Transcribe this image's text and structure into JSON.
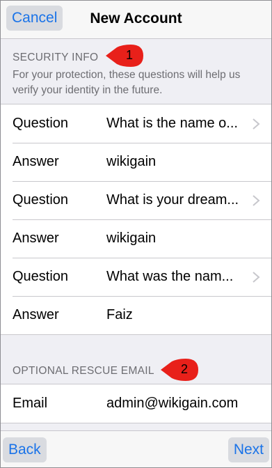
{
  "navbar": {
    "cancel_label": "Cancel",
    "title": "New Account"
  },
  "security": {
    "header": "SECURITY INFO",
    "description": "For your protection, these questions will help us verify your identity in the future.",
    "rows": [
      {
        "label": "Question",
        "value": "What is the name o...",
        "chevron": "chevron-right-icon"
      },
      {
        "label": "Answer",
        "value": "wikigain"
      },
      {
        "label": "Question",
        "value": "What is your dream...",
        "chevron": "chevron-right-icon"
      },
      {
        "label": "Answer",
        "value": "wikigain"
      },
      {
        "label": "Question",
        "value": "What was the nam...",
        "chevron": "chevron-right-icon"
      },
      {
        "label": "Answer",
        "value": "Faiz"
      }
    ]
  },
  "rescue": {
    "header": "OPTIONAL RESCUE EMAIL",
    "rows": [
      {
        "label": "Email",
        "value": "admin@wikigain.com"
      }
    ]
  },
  "callouts": [
    "1",
    "2"
  ],
  "bottombar": {
    "back_label": "Back",
    "next_label": "Next"
  },
  "colors": {
    "accent": "#1a73e8",
    "callout": "#e8201a",
    "background": "#efeff4"
  }
}
